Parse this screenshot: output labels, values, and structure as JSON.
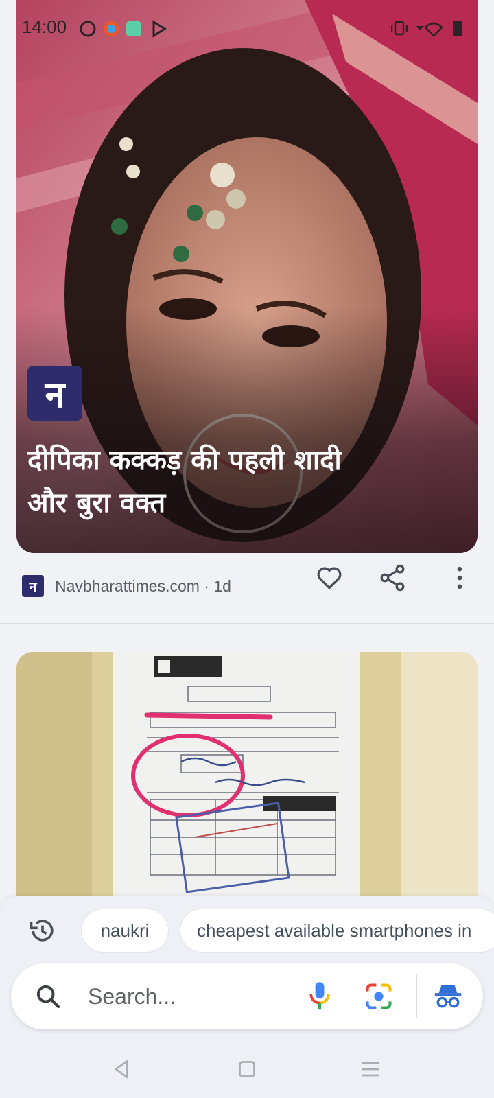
{
  "status_bar": {
    "time": "14:00"
  },
  "article1": {
    "badge_letter": "न",
    "headline_line1": "दीपिका कक्कड़ की पहली शादी",
    "headline_line2": "और बुरा वक्त",
    "source": "Navbharattimes.com · 1d",
    "source_logo_letter": "न"
  },
  "bottom_sheet": {
    "history_chips": [
      "naukri",
      "cheapest available smartphones in"
    ],
    "search_placeholder": "Search..."
  },
  "colors": {
    "badge_bg": "#2e2c6c",
    "sheet_bg": "#eef0f5"
  }
}
